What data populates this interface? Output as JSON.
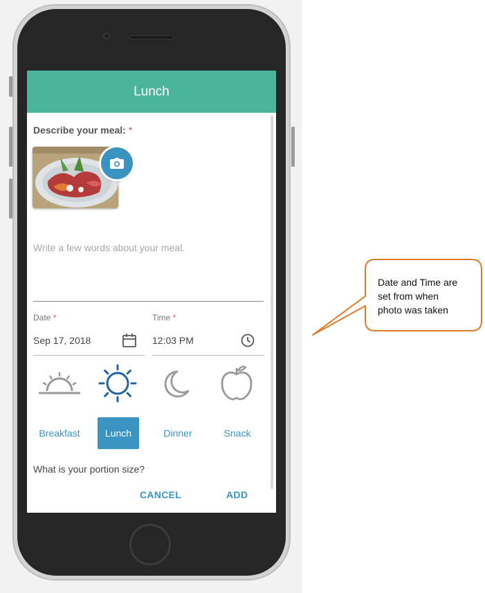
{
  "screen": {
    "header_title": "Lunch",
    "describe_label": "Describe your meal:",
    "required_mark": "*",
    "description_placeholder": "Write a few words about your meal.",
    "date": {
      "label": "Date",
      "value": "Sep 17, 2018"
    },
    "time": {
      "label": "Time",
      "value": "12:03 PM"
    },
    "meal_types": [
      {
        "label": "Breakfast",
        "icon": "sunrise-icon",
        "selected": false
      },
      {
        "label": "Lunch",
        "icon": "sun-icon",
        "selected": true
      },
      {
        "label": "Dinner",
        "icon": "moon-icon",
        "selected": false
      },
      {
        "label": "Snack",
        "icon": "apple-icon",
        "selected": false
      }
    ],
    "portion_question": "What is your portion size?",
    "cancel_label": "CANCEL",
    "add_label": "ADD"
  },
  "callout": {
    "lines": [
      "Date and Time are",
      "set from when",
      "photo was taken"
    ]
  },
  "colors": {
    "header": "#4ab59b",
    "accent": "#3b93c1",
    "required": "#e05555",
    "callout_border": "#e07b2a"
  }
}
